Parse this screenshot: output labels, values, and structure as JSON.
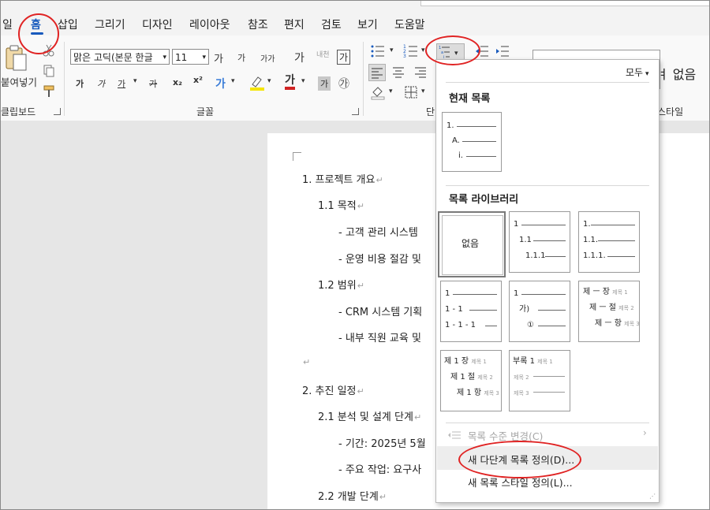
{
  "menu": {
    "tabs": [
      "일",
      "홈",
      "삽입",
      "그리기",
      "디자인",
      "레이아웃",
      "참조",
      "편지",
      "검토",
      "보기",
      "도움말"
    ],
    "active_tab": "홈"
  },
  "ribbon": {
    "clipboard": {
      "paste_label": "붙여넣기",
      "group_label": "클립보드"
    },
    "font": {
      "font_name": "맑은 고딕(본문 한글",
      "font_size": "11",
      "grow_label": "가",
      "shrink_label": "가",
      "case_label": "가가",
      "clear_format_label": "가",
      "phonetic_label": "내천",
      "char_border_label": "가",
      "bold_label": "가",
      "italic_label": "가",
      "underline_label": "가",
      "strike_label": "가",
      "subscript_label": "x₂",
      "superscript_label": "x²",
      "effects_label": "가",
      "font_color_label": "가",
      "char_shading_label": "가",
      "enclose_label": "㉮",
      "group_label": "글꼴"
    },
    "paragraph": {
      "group_label": "단"
    },
    "styles": {
      "gallery_label": "ㅕ 없음",
      "group_label": "스타일"
    }
  },
  "document": {
    "lines": [
      "1. 프로젝트 개요",
      "1.1 목적",
      "- 고객 관리 시스템",
      "- 운영 비용 절감 및",
      "1.2 범위",
      "- CRM 시스템 기획",
      "- 내부 직원 교육 및",
      "",
      "2. 추진 일정",
      "2.1 분석 및 설계 단계",
      "- 기간: 2025년 5월",
      "- 주요 작업: 요구사",
      "2.2 개발 단계"
    ],
    "para_mark": "↵"
  },
  "multilevel_dropdown": {
    "filter_label": "모두",
    "current_list_heading": "현재 목록",
    "library_heading": "목록 라이브러리",
    "current_tile": {
      "labels": [
        "1.",
        "A.",
        "i."
      ]
    },
    "tiles": [
      {
        "labels": [
          "없음"
        ]
      },
      {
        "labels": [
          "1",
          "1.1",
          "1.1.1"
        ]
      },
      {
        "labels": [
          "1.",
          "1.1.",
          "1.1.1."
        ]
      },
      {
        "labels": [
          "1",
          "1 - 1",
          "1 - 1 - 1"
        ]
      },
      {
        "labels": [
          "1",
          "가)",
          "①"
        ]
      },
      {
        "labels": [
          "제 ㅡ 장",
          "제 ㅡ 절",
          "제 ㅡ 항"
        ],
        "ghost": [
          "제목 1",
          "제목 2",
          "제목 3"
        ]
      },
      {
        "labels": [
          "제 1 장",
          "제 1 절",
          "제 1 항"
        ],
        "ghost": [
          "제목 1",
          "제목 2",
          "제목 3"
        ]
      },
      {
        "labels": [
          "부록 1"
        ],
        "ghost": [
          "제목 1",
          "제목 2",
          "제목 3"
        ]
      }
    ],
    "change_level_label": "목록 수준 변경(C)",
    "new_multilevel_label": "새 다단계 목록 정의(D)...",
    "new_list_style_label": "새 목록 스타일 정의(L)..."
  },
  "colors": {
    "accent": "#185abd",
    "annotation": "#e02323",
    "highlight_yellow": "#f5e500",
    "font_red": "#d12323"
  }
}
